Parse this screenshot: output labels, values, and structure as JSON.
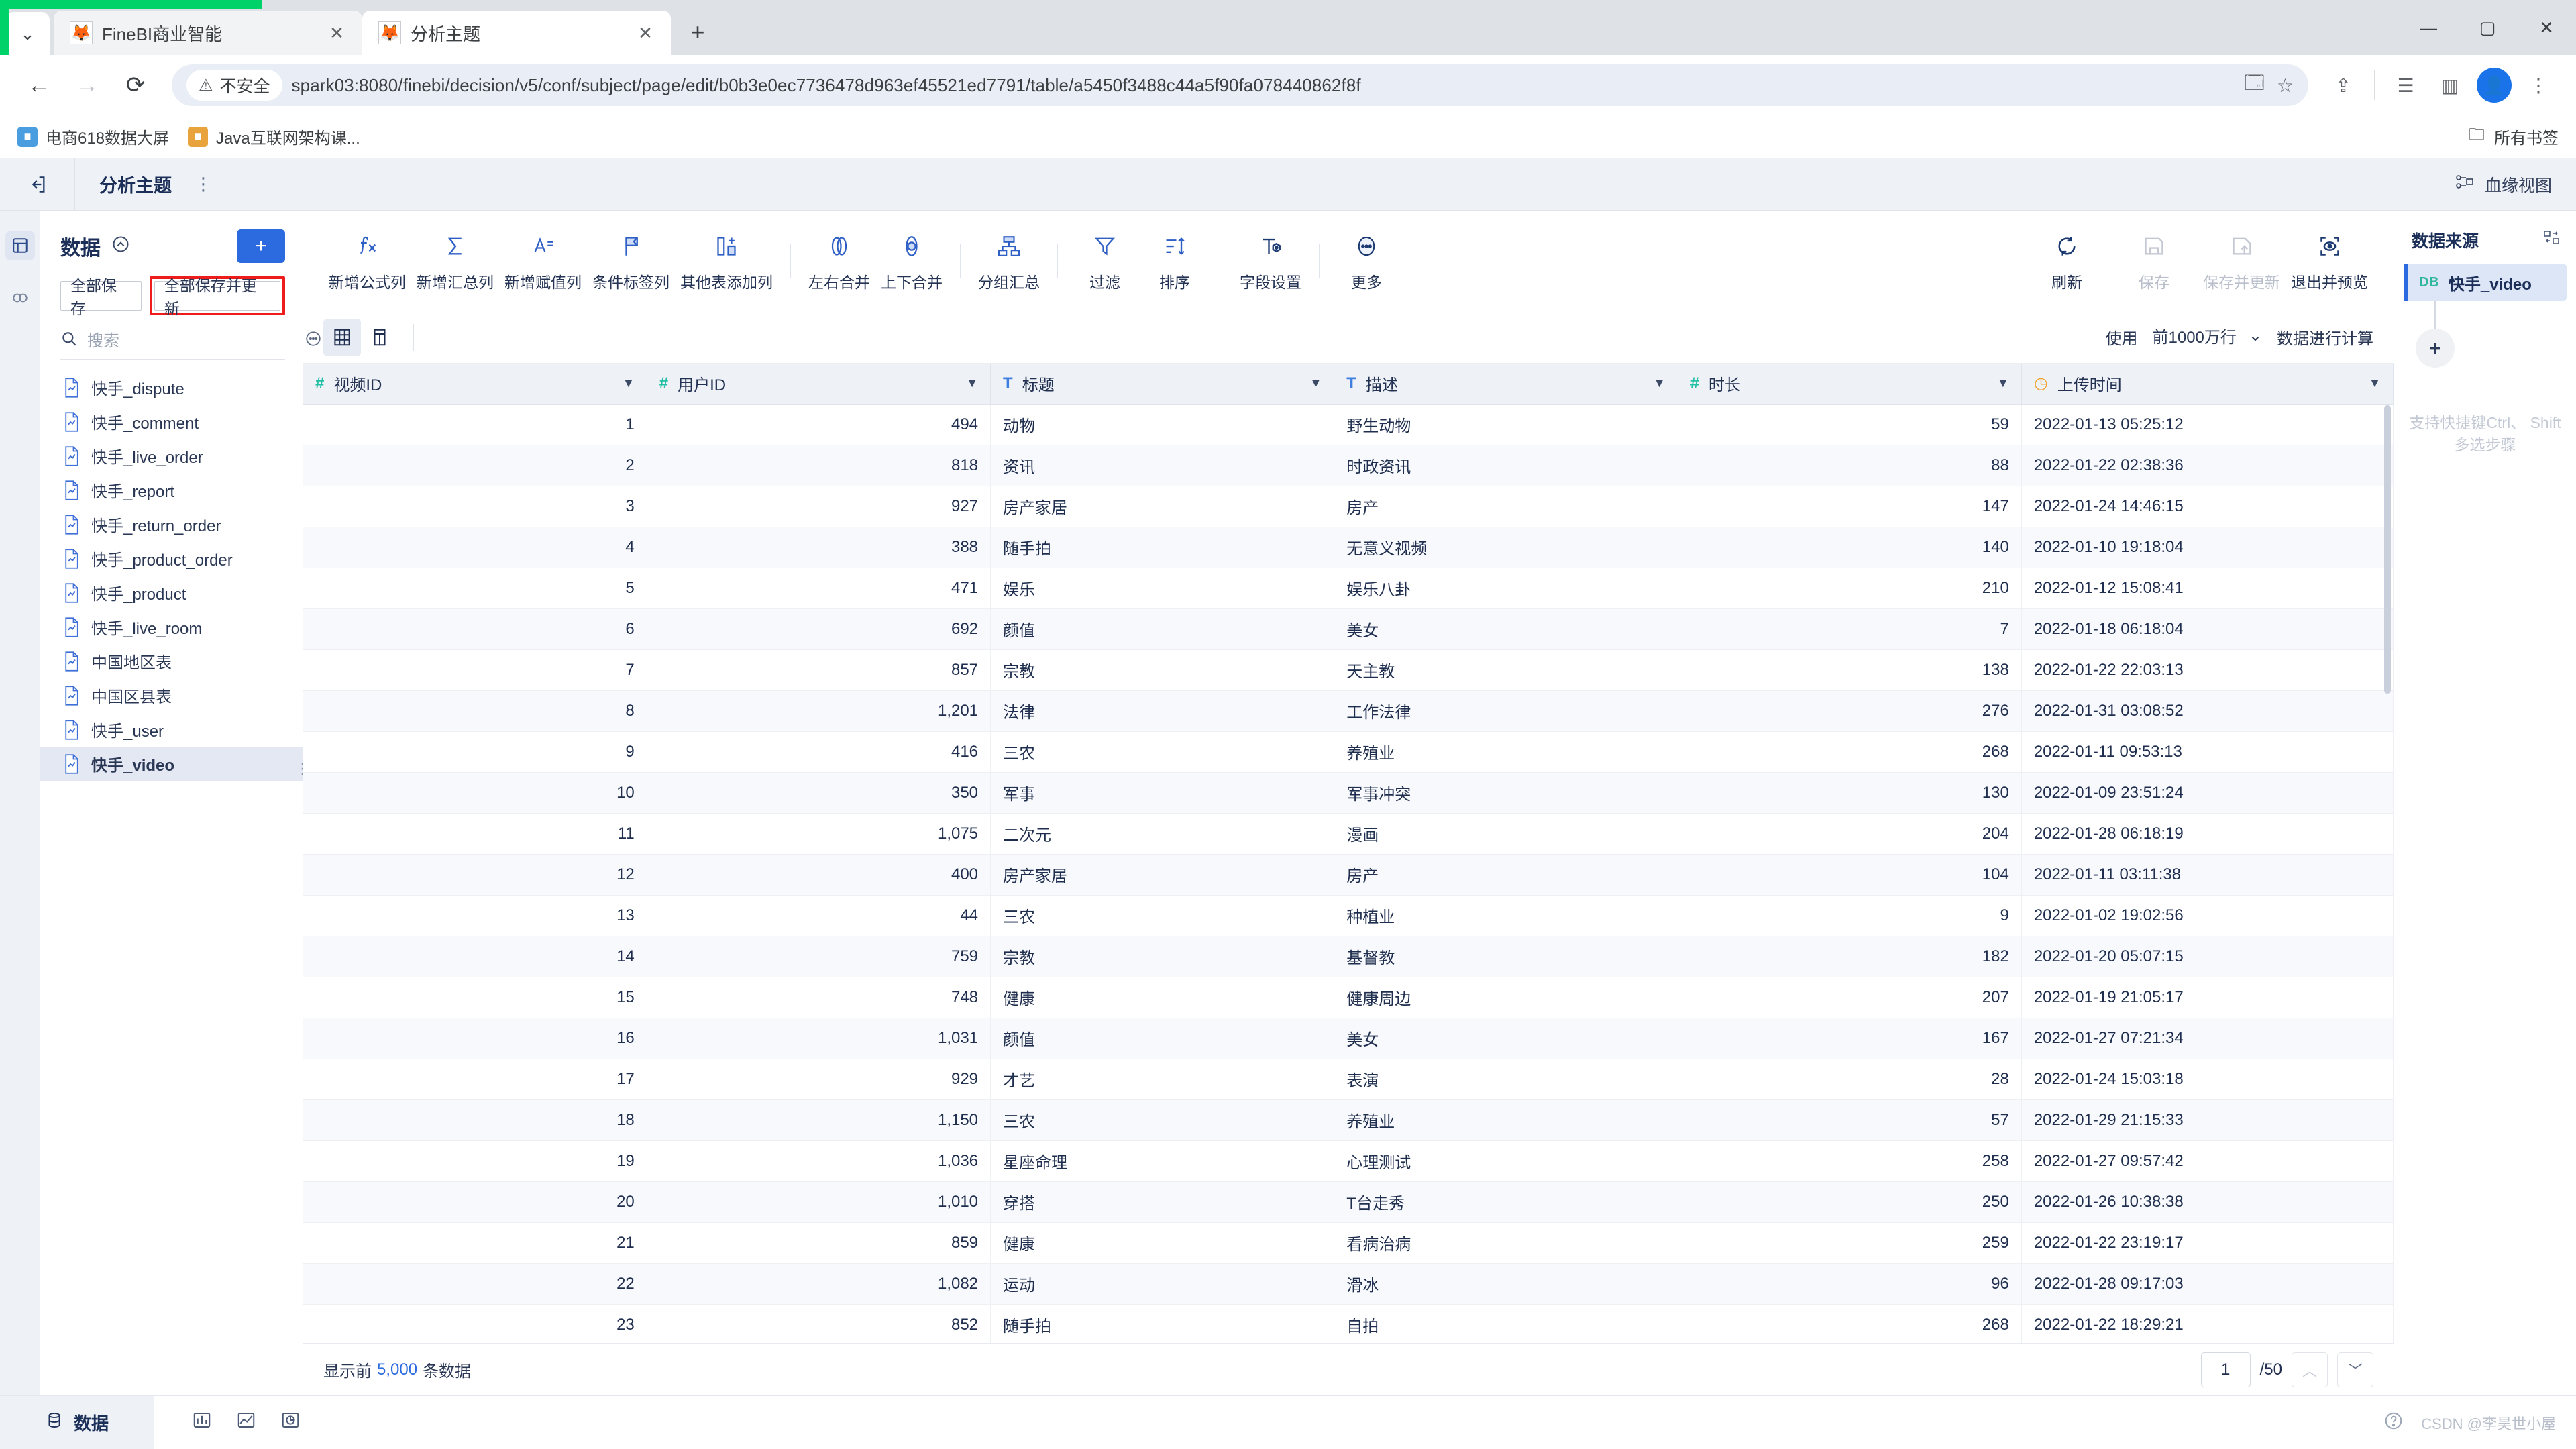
{
  "browser": {
    "tabs": [
      {
        "title": "FineBI商业智能",
        "favicon": "finebi-icon",
        "active": false
      },
      {
        "title": "分析主题",
        "favicon": "finebi-icon",
        "active": true
      }
    ],
    "new_tab_label": "+",
    "tab_close_label": "✕",
    "tab_list_label": "⌄",
    "nav": {
      "back": "←",
      "forward": "→",
      "reload": "⟳"
    },
    "security_label": "不安全",
    "url": "spark03:8080/finebi/decision/v5/conf/subject/page/edit/b0b3e0ec7736478d963ef45521ed7791/table/a5450f3488c44a5f90fa078440862f8f",
    "window_controls": {
      "minimize": "—",
      "maximize": "▢",
      "close": "✕"
    },
    "bookmarks": [
      {
        "label": "电商618数据大屏",
        "icon": "bookmark-icon"
      },
      {
        "label": "Java互联网架构课...",
        "icon": "bookmark-icon"
      }
    ],
    "bookmarks_all_label": "所有书签"
  },
  "app_header": {
    "exit_icon": "exit-left-icon",
    "title": "分析主题",
    "overflow_icon": "vertical-dots-icon",
    "lineage_label": "血缘视图",
    "lineage_icon": "lineage-icon"
  },
  "rail": {
    "items": [
      {
        "name": "table-view",
        "icon": "grid-icon",
        "active": true
      },
      {
        "name": "relation-view",
        "icon": "relation-icon",
        "active": false
      }
    ]
  },
  "data_panel": {
    "title": "数据",
    "collapse_icon": "collapse-up-icon",
    "add_label": "+",
    "save_all_label": "全部保存",
    "save_update_all_label": "全部保存并更新",
    "search_placeholder": "搜索",
    "search_value": "",
    "more_icon": "ellipsis-icon",
    "tables": [
      {
        "label": "快手_dispute",
        "selected": false
      },
      {
        "label": "快手_comment",
        "selected": false
      },
      {
        "label": "快手_live_order",
        "selected": false
      },
      {
        "label": "快手_report",
        "selected": false
      },
      {
        "label": "快手_return_order",
        "selected": false
      },
      {
        "label": "快手_product_order",
        "selected": false
      },
      {
        "label": "快手_product",
        "selected": false
      },
      {
        "label": "快手_live_room",
        "selected": false
      },
      {
        "label": "中国地区表",
        "selected": false
      },
      {
        "label": "中国区县表",
        "selected": false
      },
      {
        "label": "快手_user",
        "selected": false
      },
      {
        "label": "快手_video",
        "selected": true
      }
    ]
  },
  "toolbar": {
    "items": [
      {
        "label": "新增公式列",
        "icon": "fx-icon",
        "disabled": false
      },
      {
        "label": "新增汇总列",
        "icon": "sigma-icon",
        "disabled": false
      },
      {
        "label": "新增赋值列",
        "icon": "assign-column-icon",
        "disabled": false
      },
      {
        "label": "条件标签列",
        "icon": "flag-icon",
        "disabled": false
      },
      {
        "label": "其他表添加列",
        "icon": "add-column-icon",
        "disabled": false
      },
      {
        "label": "左右合并",
        "icon": "merge-horizontal-icon",
        "disabled": false
      },
      {
        "label": "上下合并",
        "icon": "merge-vertical-icon",
        "disabled": false
      },
      {
        "label": "分组汇总",
        "icon": "group-summary-icon",
        "disabled": false
      },
      {
        "label": "过滤",
        "icon": "filter-icon",
        "disabled": false
      },
      {
        "label": "排序",
        "icon": "sort-icon",
        "disabled": false
      },
      {
        "label": "字段设置",
        "icon": "field-settings-icon",
        "disabled": false
      },
      {
        "label": "更多",
        "icon": "more-ellipsis-icon",
        "disabled": false
      }
    ],
    "right_items": [
      {
        "label": "刷新",
        "icon": "refresh-icon",
        "disabled": false
      },
      {
        "label": "保存",
        "icon": "save-icon",
        "disabled": true
      },
      {
        "label": "保存并更新",
        "icon": "save-update-icon",
        "disabled": true
      },
      {
        "label": "退出并预览",
        "icon": "preview-icon",
        "disabled": false
      }
    ]
  },
  "subbar": {
    "grid_view_icon": "grid-view-icon",
    "column_view_icon": "column-view-icon",
    "use_label": "使用",
    "rows_value": "前1000万行",
    "rows_caret": "⌄",
    "compute_label": "数据进行计算"
  },
  "table": {
    "columns": [
      {
        "name": "视频ID",
        "type": "number",
        "type_icon": "hash-icon",
        "align": "num"
      },
      {
        "name": "用户ID",
        "type": "number",
        "type_icon": "hash-icon",
        "align": "num"
      },
      {
        "name": "标题",
        "type": "text",
        "type_icon": "text-icon",
        "align": "txt"
      },
      {
        "name": "描述",
        "type": "text",
        "type_icon": "text-icon",
        "align": "txt"
      },
      {
        "name": "时长",
        "type": "number",
        "type_icon": "hash-icon",
        "align": "num"
      },
      {
        "name": "上传时间",
        "type": "datetime",
        "type_icon": "clock-icon",
        "align": "txt"
      }
    ],
    "rows": [
      [
        "1",
        "494",
        "动物",
        "野生动物",
        "59",
        "2022-01-13 05:25:12"
      ],
      [
        "2",
        "818",
        "资讯",
        "时政资讯",
        "88",
        "2022-01-22 02:38:36"
      ],
      [
        "3",
        "927",
        "房产家居",
        "房产",
        "147",
        "2022-01-24 14:46:15"
      ],
      [
        "4",
        "388",
        "随手拍",
        "无意义视频",
        "140",
        "2022-01-10 19:18:04"
      ],
      [
        "5",
        "471",
        "娱乐",
        "娱乐八卦",
        "210",
        "2022-01-12 15:08:41"
      ],
      [
        "6",
        "692",
        "颜值",
        "美女",
        "7",
        "2022-01-18 06:18:04"
      ],
      [
        "7",
        "857",
        "宗教",
        "天主教",
        "138",
        "2022-01-22 22:03:13"
      ],
      [
        "8",
        "1,201",
        "法律",
        "工作法律",
        "276",
        "2022-01-31 03:08:52"
      ],
      [
        "9",
        "416",
        "三农",
        "养殖业",
        "268",
        "2022-01-11 09:53:13"
      ],
      [
        "10",
        "350",
        "军事",
        "军事冲突",
        "130",
        "2022-01-09 23:51:24"
      ],
      [
        "11",
        "1,075",
        "二次元",
        "漫画",
        "204",
        "2022-01-28 06:18:19"
      ],
      [
        "12",
        "400",
        "房产家居",
        "房产",
        "104",
        "2022-01-11 03:11:38"
      ],
      [
        "13",
        "44",
        "三农",
        "种植业",
        "9",
        "2022-01-02 19:02:56"
      ],
      [
        "14",
        "759",
        "宗教",
        "基督教",
        "182",
        "2022-01-20 05:07:15"
      ],
      [
        "15",
        "748",
        "健康",
        "健康周边",
        "207",
        "2022-01-19 21:05:17"
      ],
      [
        "16",
        "1,031",
        "颜值",
        "美女",
        "167",
        "2022-01-27 07:21:34"
      ],
      [
        "17",
        "929",
        "才艺",
        "表演",
        "28",
        "2022-01-24 15:03:18"
      ],
      [
        "18",
        "1,150",
        "三农",
        "养殖业",
        "57",
        "2022-01-29 21:15:33"
      ],
      [
        "19",
        "1,036",
        "星座命理",
        "心理测试",
        "258",
        "2022-01-27 09:57:42"
      ],
      [
        "20",
        "1,010",
        "穿搭",
        "T台走秀",
        "250",
        "2022-01-26 10:38:38"
      ],
      [
        "21",
        "859",
        "健康",
        "看病治病",
        "259",
        "2022-01-22 23:19:17"
      ],
      [
        "22",
        "1,082",
        "运动",
        "滑冰",
        "96",
        "2022-01-28 09:17:03"
      ],
      [
        "23",
        "852",
        "随手拍",
        "自拍",
        "268",
        "2022-01-22 18:29:21"
      ]
    ]
  },
  "status": {
    "prefix": "显示前",
    "count": "5,000",
    "suffix": "条数据",
    "page_value": "1",
    "total_pages": "/50",
    "prev_icon": "chevron-up-icon",
    "next_icon": "chevron-down-icon"
  },
  "right_panel": {
    "title": "数据来源",
    "layout_icon": "layout-switch-icon",
    "node_badge": "DB",
    "node_label": "快手_video",
    "add_label": "+",
    "hint_line1": "支持快捷键Ctrl、 Shift",
    "hint_line2": "多选步骤"
  },
  "footer": {
    "tab_label": "数据",
    "tab_icon": "database-icon",
    "icons": [
      "chart-bar-icon",
      "chart-area-icon",
      "chart-pie-icon"
    ],
    "help_icon": "help-icon",
    "watermark": "CSDN @李昊世小屋"
  }
}
